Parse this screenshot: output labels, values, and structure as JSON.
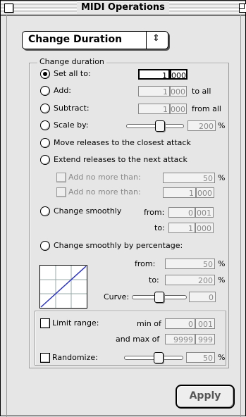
{
  "window": {
    "title": "MIDI Operations"
  },
  "operation_popup": {
    "selected": "Change Duration",
    "arrows": "⇕"
  },
  "group": {
    "label": "Change duration"
  },
  "options": {
    "set_all_to": {
      "label": "Set all to:",
      "v1": "1",
      "v2": "000"
    },
    "add": {
      "label": "Add:",
      "v1": "1",
      "v2": "000",
      "suffix": "to all"
    },
    "subtract": {
      "label": "Subtract:",
      "v1": "1",
      "v2": "000",
      "suffix": "from all"
    },
    "scale_by": {
      "label": "Scale by:",
      "value": "200",
      "unit": "%",
      "slider_level": 0.6
    },
    "move_releases": {
      "label": "Move releases to the closest attack"
    },
    "extend_releases": {
      "label": "Extend releases to the next attack"
    },
    "add_no_more_1": {
      "label": "Add no more than:",
      "value": "50",
      "unit": "%"
    },
    "add_no_more_2": {
      "label": "Add no more than:",
      "v1": "1",
      "v2": "000"
    },
    "change_smoothly": {
      "label": "Change smoothly",
      "from_label": "from:",
      "from_v1": "0",
      "from_v2": "001",
      "to_label": "to:",
      "to_v1": "1",
      "to_v2": "000"
    },
    "change_smoothly_pct": {
      "label": "Change smoothly by percentage:",
      "from_label": "from:",
      "from_value": "50",
      "to_label": "to:",
      "to_value": "200",
      "unit": "%",
      "curve_label": "Curve:",
      "curve_value": "0",
      "curve_level": 0.5
    }
  },
  "limit_range": {
    "label": "Limit range:",
    "min_label": "min of",
    "min_v1": "0",
    "min_v2": "001",
    "max_label": "and max of",
    "max_v1": "9999",
    "max_v2": "999"
  },
  "randomize": {
    "label": "Randomize:",
    "value": "50",
    "unit": "%",
    "slider_level": 0.6
  },
  "apply_button": {
    "label": "Apply"
  }
}
